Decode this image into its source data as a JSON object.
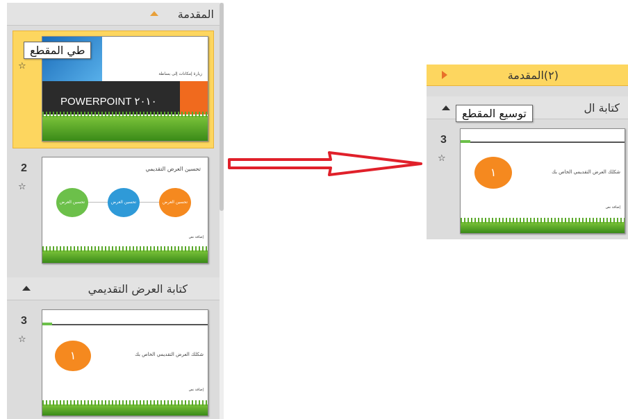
{
  "left_pane": {
    "section_intro": "المقدمة",
    "section_writing": "كتابة العرض التقديمي",
    "tooltip": "طي المقطع",
    "slide1": {
      "title": "POWERPOINT ٢٠١٠",
      "subtitle": "زيارة إمكانات إلى بساطة"
    },
    "slide2": {
      "number": "2",
      "title": "تحسين العرض التقديمي",
      "circle1": "تحسين العرض",
      "circle2": "تحسين العرض",
      "circle3": "تحسين العرض",
      "footer": "إضافة نص"
    },
    "slide3": {
      "number": "3",
      "circle_label": "١",
      "caption": "شكلك العرض التقديمي الخاص بك",
      "footer": "إضافة نص"
    }
  },
  "right_pane": {
    "section_collapsed": "(٢)المقدمة",
    "section_writing": "كتابة ال",
    "tooltip": "توسيع المقطع",
    "slide3": {
      "number": "3",
      "circle_label": "١",
      "caption": "شكلك العرض التقديمي الخاص بك",
      "footer": "إضافة نص"
    }
  },
  "icons": {
    "star": "☆",
    "animation": "animation-icon"
  },
  "colors": {
    "selected": "#fdd65f",
    "arrow": "#e0202a",
    "orange": "#f5891f",
    "blue": "#2f9ad8",
    "green": "#6cc04a"
  }
}
